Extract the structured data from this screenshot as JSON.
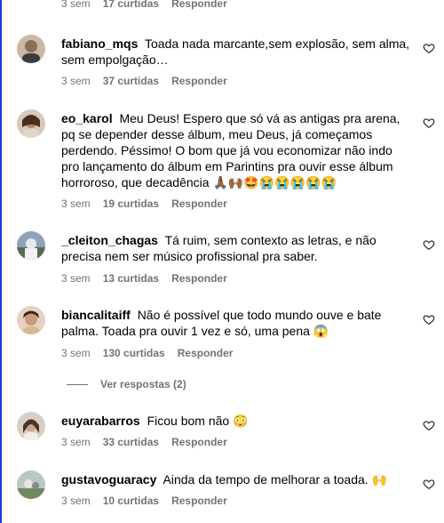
{
  "top": {
    "time": "3 sem",
    "likes": "17 curtidas",
    "reply": "Responder"
  },
  "comments": [
    {
      "username": "fabiano_mqs",
      "text": "Toada nada marcante,sem explosão, sem alma, sem empolgação…",
      "time": "3 sem",
      "likes": "37 curtidas",
      "reply": "Responder"
    },
    {
      "username": "eo_karol",
      "text": "Meu Deus! Espero que só vá as antigas pra arena, pq se depender desse álbum, meu Deus, já começamos perdendo. Péssimo! O bom que já vou economizar não indo pro lançamento do álbum em Parintins pra ouvir esse álbum horroroso, que decadência 🙏🏾🙌🏾🤩😭😭😭😭😭",
      "time": "3 sem",
      "likes": "19 curtidas",
      "reply": "Responder"
    },
    {
      "username": "_cleiton_chagas",
      "text": "Tá ruim, sem contexto as letras, e não precisa nem ser músico profissional pra saber.",
      "time": "3 sem",
      "likes": "13 curtidas",
      "reply": "Responder"
    },
    {
      "username": "biancalitaiff",
      "text": "Não é possível que todo mundo ouve e bate palma. Toada pra ouvir 1 vez e só, uma pena 😱",
      "time": "3 sem",
      "likes": "130 curtidas",
      "reply": "Responder",
      "view_replies": "Ver respostas (2)"
    },
    {
      "username": "euyarabarros",
      "text": "Ficou bom não 😳",
      "time": "3 sem",
      "likes": "33 curtidas",
      "reply": "Responder"
    },
    {
      "username": "gustavoguaracy",
      "text": "Ainda da tempo de melhorar a toada. 🙌",
      "time": "3 sem",
      "likes": "10 curtidas",
      "reply": "Responder"
    }
  ],
  "colors": {
    "meta": "#737373",
    "accent_border": "#1a3cd8"
  },
  "icons": {
    "like": "heart-outline-icon"
  }
}
